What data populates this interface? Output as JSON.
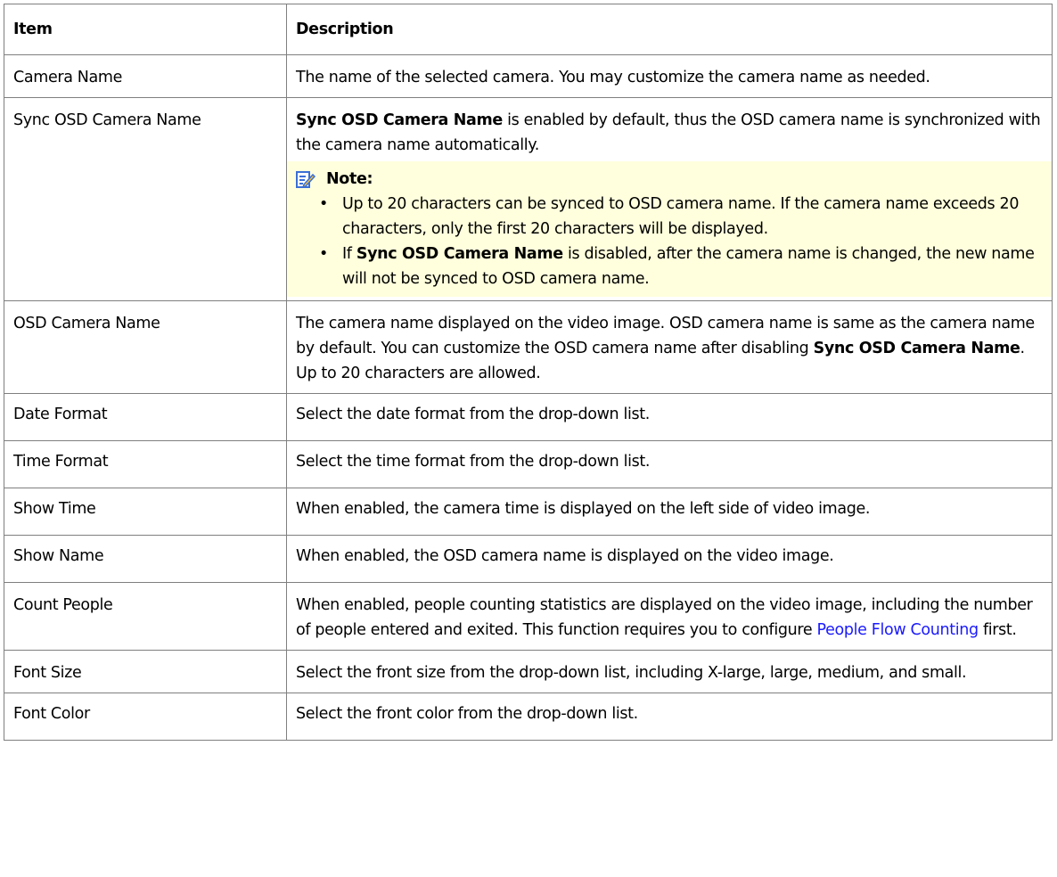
{
  "header": {
    "item": "Item",
    "description": "Description"
  },
  "rows": [
    {
      "item": "Camera Name",
      "desc": "The name of the selected camera. You may customize the camera name as needed."
    },
    {
      "item": "Sync OSD Camera Name",
      "desc_bold": "Sync OSD Camera Name",
      "desc_rest": " is enabled by default, thus the OSD camera name is synchronized with the camera name automatically.",
      "note_title": "Note:",
      "note_items": [
        {
          "text": "Up to 20 characters can be synced to OSD camera name. If the camera name exceeds 20 characters, only the first 20 characters will be displayed."
        },
        {
          "pre": "If ",
          "bold": "Sync OSD Camera Name",
          "post": " is disabled, after the camera name is changed, the new name will not be synced to OSD camera name."
        }
      ]
    },
    {
      "item": "OSD Camera Name",
      "desc_pre": "The camera name displayed on the video image. OSD camera name is same as the camera name by default. You can customize the OSD camera name after disabling ",
      "desc_bold": "Sync OSD Camera Name",
      "desc_post": ". Up to 20 characters are allowed."
    },
    {
      "item": "Date Format",
      "desc": "Select the date format from the drop-down list."
    },
    {
      "item": "Time Format",
      "desc": "Select the time format from the drop-down list."
    },
    {
      "item": "Show Time",
      "desc": "When enabled, the camera time is displayed on the left side of video image."
    },
    {
      "item": "Show Name",
      "desc": "When enabled, the OSD camera name is displayed on the video image."
    },
    {
      "item": "Count People",
      "desc_pre": "When enabled, people counting statistics are displayed on the video image, including the number of people entered and exited. This function requires you to configure ",
      "desc_link": "People Flow Counting",
      "desc_post": " first."
    },
    {
      "item": "Font Size",
      "desc": "Select the front size from the drop-down list, including X-large, large, medium, and small."
    },
    {
      "item": "Font Color",
      "desc": "Select the front color from the drop-down list."
    }
  ],
  "colors": {
    "link": "#1a1aff",
    "note_bg": "#ffffdd",
    "border": "#7f7f7f",
    "note_icon": "#3b6fd6"
  },
  "icons": {
    "note": "note-pencil-icon"
  }
}
